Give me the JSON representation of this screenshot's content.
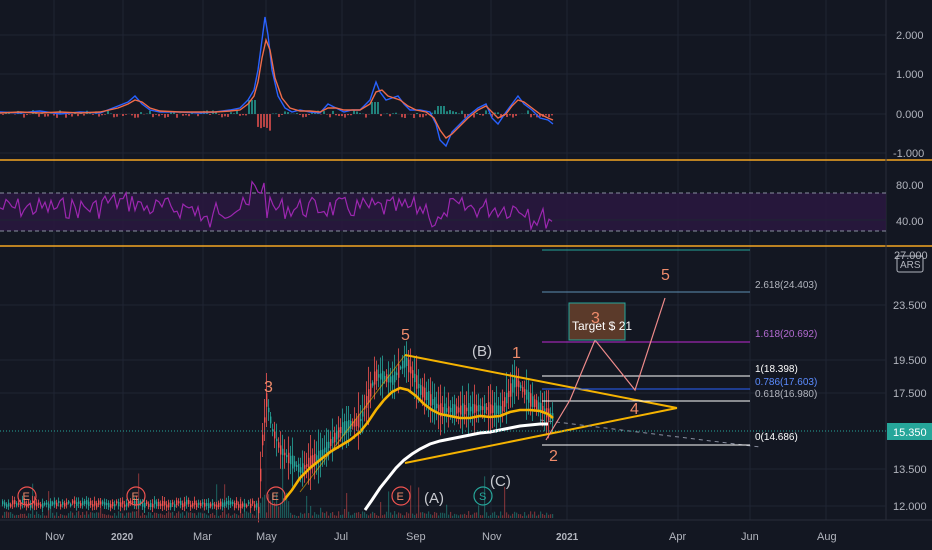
{
  "colors": {
    "background": "#131722",
    "grid": "#1f2433",
    "separator": "#f5a623",
    "macd_line": "#2962ff",
    "signal_line": "#ff6d00",
    "rsi_line": "#9c27b0",
    "rsi_band": "#2a1740",
    "price_up": "#26a69a",
    "price_down": "#ef5350",
    "triangle": "#f5b301",
    "ma_fast": "#f5b301",
    "ma_slow": "#ffffff",
    "wave_label": "#ef8b6b",
    "correction_label": "#b2b5be",
    "fib_extension": "#9c27b0",
    "fib_line": "#b2b5be",
    "current_price_bg": "#26a69a",
    "target_box": "#5b3a2a"
  },
  "macd_axis": {
    "ticks": [
      "2.000",
      "1.000",
      "0.000",
      "-1.000"
    ]
  },
  "rsi_axis": {
    "ticks": [
      "80.00",
      "40.00"
    ]
  },
  "price_axis": {
    "ticks": [
      "23.500",
      "19.500",
      "17.500",
      "13.500",
      "12.000"
    ],
    "top_partial": "27.000",
    "currency_badge": "ARS"
  },
  "current_price": "15.350",
  "time_axis": [
    "Nov",
    "2020",
    "Mar",
    "May",
    "Jul",
    "Sep",
    "Nov",
    "2021",
    "Apr",
    "Jun",
    "Aug"
  ],
  "wave_labels": {
    "w3": "3",
    "w5": "5",
    "w1": "1",
    "w2": "2",
    "proj3": "3",
    "proj4": "4",
    "proj5": "5"
  },
  "correction_labels": {
    "A": "(A)",
    "B": "(B)",
    "C": "(C)"
  },
  "target_label": "Target $ 21",
  "fib_levels": [
    {
      "label": "2.618(24.403)",
      "color_key": "fib_line"
    },
    {
      "label": "1.618(20.692)",
      "color_key": "fib_extension"
    },
    {
      "label": "1(18.398)",
      "color_key": "fib_line"
    },
    {
      "label": "0.786(17.603)",
      "color_key": "fib_blue"
    },
    {
      "label": "0.618(16.980)",
      "color_key": "fib_line"
    },
    {
      "label": "0(14.686)",
      "color_key": "fib_line"
    }
  ],
  "event_markers": [
    {
      "label": "E"
    },
    {
      "label": "E"
    },
    {
      "label": "E"
    },
    {
      "label": "E"
    },
    {
      "label": "S"
    }
  ]
}
